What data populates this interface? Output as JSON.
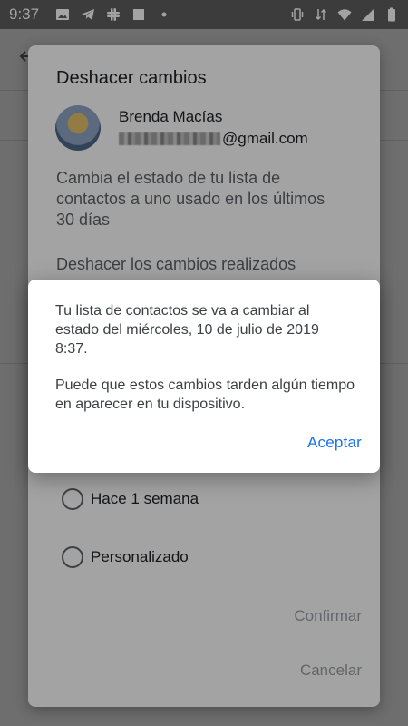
{
  "status_bar": {
    "time": "9:37",
    "left_icons": [
      "image-icon",
      "telegram-icon",
      "slack-icon",
      "square-icon",
      "dot-icon"
    ],
    "right_icons": [
      "vibrate-icon",
      "data-transfer-icon",
      "wifi-icon",
      "signal-icon",
      "battery-icon"
    ]
  },
  "dialog_back": {
    "title": "Deshacer cambios",
    "account": {
      "name": "Brenda Macías",
      "email_suffix": "@gmail.com"
    },
    "description": "Cambia el estado de tu lista de contactos a uno usado en los últimos 30 días",
    "description2": "Deshacer los cambios realizados",
    "options": [
      {
        "label": "Hace 1 semana"
      },
      {
        "label": "Personalizado"
      }
    ],
    "confirm_label": "Confirmar",
    "cancel_label": "Cancelar"
  },
  "dialog_front": {
    "message": "Tu lista de contactos se va a cambiar al estado del miércoles, 10 de julio de 2019 8:37.",
    "message2": "Puede que estos cambios tarden algún tiempo en aparecer en tu dispositivo.",
    "accept_label": "Aceptar"
  },
  "colors": {
    "accent": "#1a73e8",
    "status_bar": "#5f5f5f"
  }
}
